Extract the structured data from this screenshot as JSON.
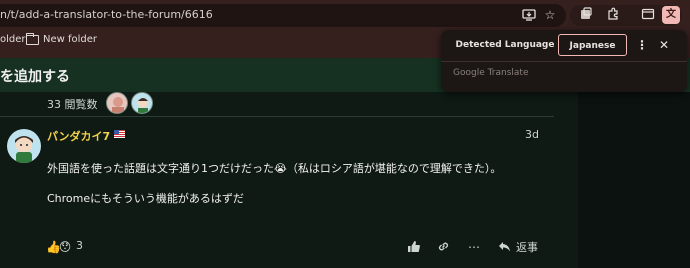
{
  "browser": {
    "url": "n/t/add-a-translator-to-the-forum/6616",
    "bookmarks": [
      {
        "label": "older"
      },
      {
        "label": "New folder"
      }
    ]
  },
  "translate_popup": {
    "tabs": [
      {
        "label": "Detected Language",
        "active": false
      },
      {
        "label": "Japanese",
        "active": true
      }
    ],
    "brand_google": "Google",
    "brand_translate": "Translate",
    "accent_color": "#f2b8b5"
  },
  "topic": {
    "title": "を追加する",
    "views": "33 閲覧数"
  },
  "post": {
    "username": "パンダカイ7",
    "date": "3d",
    "line1": "外国語を使った話題は文字通り1つだけだった😭（私はロシア語が堪能なので理解できた）。",
    "line2": "Chromeにもそういう機能があるはずだ",
    "reaction_count": "3",
    "reply_label": "返事"
  },
  "colors": {
    "username": "#f2d34a",
    "title_bar": "#163121",
    "chrome_frame": "#35201e"
  }
}
